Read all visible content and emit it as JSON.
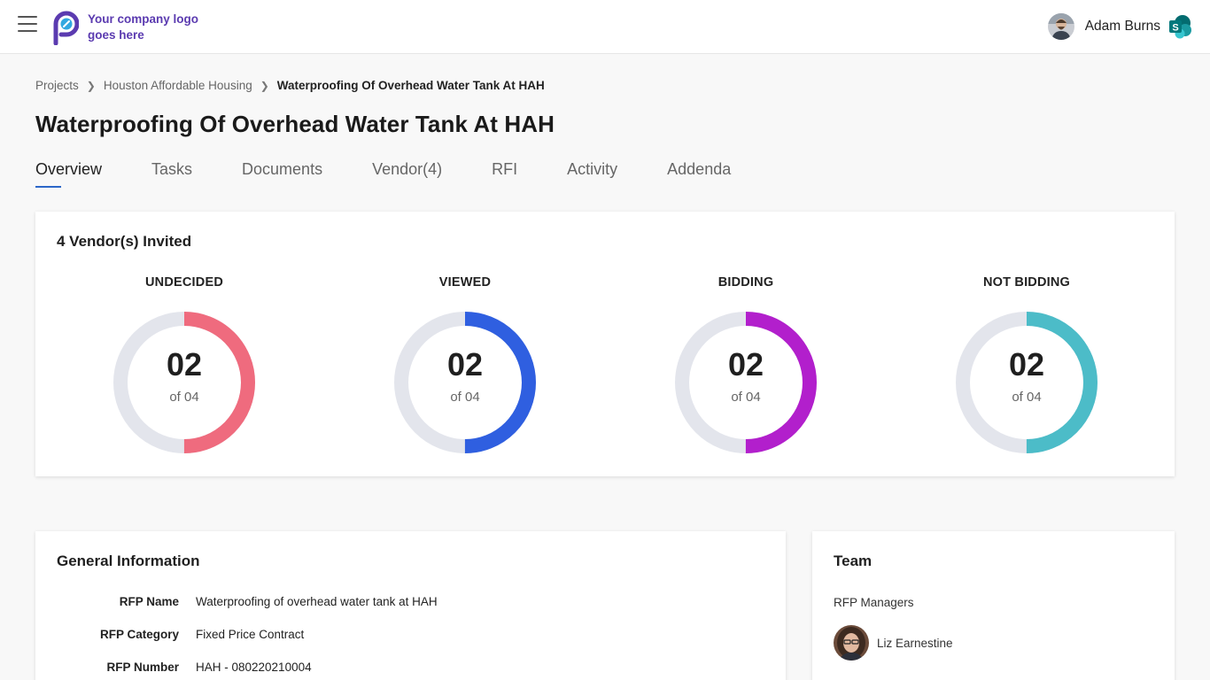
{
  "header": {
    "logo_text": "Your company logo goes here",
    "user_name": "Adam Burns"
  },
  "breadcrumb": {
    "items": [
      "Projects",
      "Houston Affordable Housing",
      "Waterproofing Of Overhead Water Tank At HAH"
    ]
  },
  "page_title": "Waterproofing Of Overhead Water Tank At HAH",
  "tabs": [
    {
      "label": "Overview",
      "active": true
    },
    {
      "label": "Tasks"
    },
    {
      "label": "Documents"
    },
    {
      "label": "Vendor(4)"
    },
    {
      "label": "RFI"
    },
    {
      "label": "Activity"
    },
    {
      "label": "Addenda"
    }
  ],
  "vendors": {
    "heading": "4 Vendor(s) Invited",
    "stats": [
      {
        "label": "UNDECIDED",
        "value": "02",
        "of": "of 04",
        "fraction": 0.5,
        "color": "#ef6b7e"
      },
      {
        "label": "VIEWED",
        "value": "02",
        "of": "of 04",
        "fraction": 0.5,
        "color": "#2f5fe0"
      },
      {
        "label": "BIDDING",
        "value": "02",
        "of": "of 04",
        "fraction": 0.5,
        "color": "#b21fcc"
      },
      {
        "label": "NOT BIDDING",
        "value": "02",
        "of": "of 04",
        "fraction": 0.5,
        "color": "#4cbcc8"
      }
    ],
    "track_color": "#e3e5ec"
  },
  "general": {
    "heading": "General Information",
    "rows": [
      {
        "label": "RFP Name",
        "value": "Waterproofing of overhead water tank at HAH"
      },
      {
        "label": "RFP Category",
        "value": "Fixed Price Contract"
      },
      {
        "label": "RFP Number",
        "value": "HAH - 080220210004"
      }
    ]
  },
  "team": {
    "heading": "Team",
    "subheading": "RFP Managers",
    "members": [
      {
        "name": "Liz Earnestine"
      }
    ]
  }
}
